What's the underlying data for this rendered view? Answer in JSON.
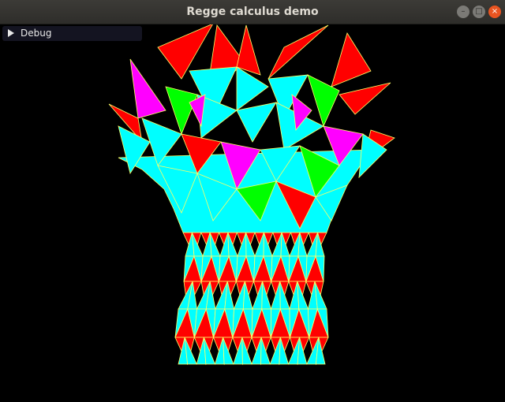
{
  "window": {
    "title": "Regge calculus demo",
    "controls": {
      "minimize": "–",
      "maximize": "□",
      "close": "×"
    }
  },
  "debug_panel": {
    "label": "Debug",
    "collapsed": true
  },
  "scene": {
    "background": "#000000",
    "colors": {
      "red": "#ff0000",
      "cyan": "#00ffff",
      "green": "#00ff00",
      "magenta": "#ff00ff",
      "edge": "#ffff66"
    }
  }
}
